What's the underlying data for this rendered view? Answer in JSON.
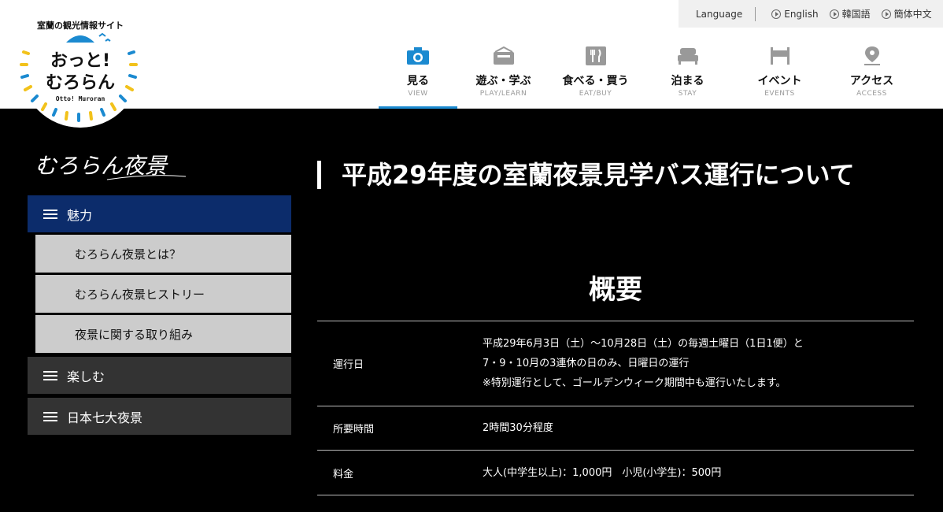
{
  "logo": {
    "tagline": "室蘭の観光情報サイト",
    "title_line1": "おっと!",
    "title_line2": "むろらん",
    "subtitle": "Otto! Muroran"
  },
  "language_bar": {
    "label": "Language",
    "items": [
      "English",
      "韓国語",
      "簡体中文"
    ]
  },
  "nav": {
    "items": [
      {
        "jp": "見る",
        "en": "VIEW",
        "icon": "camera-icon"
      },
      {
        "jp": "遊ぶ・学ぶ",
        "en": "PLAY/LEARN",
        "icon": "play-learn-icon"
      },
      {
        "jp": "食べる・買う",
        "en": "EAT/BUY",
        "icon": "fork-knife-icon"
      },
      {
        "jp": "泊まる",
        "en": "STAY",
        "icon": "bed-icon"
      },
      {
        "jp": "イベント",
        "en": "EVENTS",
        "icon": "event-flag-icon"
      },
      {
        "jp": "アクセス",
        "en": "ACCESS",
        "icon": "map-pin-icon"
      }
    ],
    "active_color": "#1b8ad0"
  },
  "sidebar": {
    "title": "むろらん夜景",
    "categories": [
      {
        "label": "魅力",
        "sub_items": [
          "むろらん夜景とは？",
          "むろらん夜景ヒストリー",
          "夜景に関する取り組み"
        ]
      },
      {
        "label": "楽しむ"
      },
      {
        "label": "日本七大夜景"
      }
    ]
  },
  "main": {
    "title": "平成29年度の室蘭夜景見学バス運行について",
    "section_heading": "概要",
    "rows": [
      {
        "key": "運行日",
        "lines": [
          "平成29年6月3日（土）～10月28日（土）の毎週土曜日（1日1便）と",
          "7・9・10月の3連休の日のみ、日曜日の運行",
          "※特別運行として、ゴールデンウィーク期間中も運行いたします。"
        ]
      },
      {
        "key": "所要時間",
        "lines": [
          "2時間30分程度"
        ]
      },
      {
        "key": "料金",
        "lines": [
          "大人(中学生以上)：1,000円　小児(小学生)：500円"
        ]
      }
    ]
  },
  "colors": {
    "page_bg": "#000000",
    "active_category": "#0c2c6b",
    "category": "#333333",
    "sub_item": "#cccccc"
  }
}
